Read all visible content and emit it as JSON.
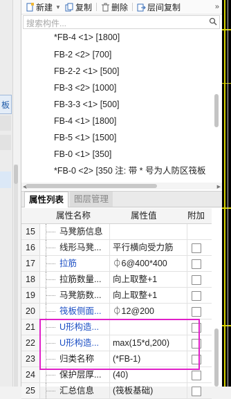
{
  "left_strip": {
    "tab_label": "板"
  },
  "toolbar": {
    "new_label": "新建",
    "copy_label": "复制",
    "delete_label": "删除",
    "floor_copy_label": "层间复制",
    "more_label": "»"
  },
  "search": {
    "placeholder": "搜索构件..."
  },
  "component_list": [
    "*FB-4 <1> [1800]",
    "FB-2 <2> [700]",
    "FB-2-2 <1> [500]",
    "FB-3 <2> [1000]",
    "FB-3-3 <1> [500]",
    "FB-4 <1> [1800]",
    "FB-5 <1> [1500]",
    "FB-0 <1> [350]",
    "*FB-0 <2> [350 注: 带 * 号为人防区筏板"
  ],
  "tabs": {
    "properties": "属性列表",
    "layers": "图层管理"
  },
  "grid": {
    "headers": {
      "name": "属性名称",
      "value": "属性值",
      "extra": "附加"
    },
    "rows": [
      {
        "num": "15",
        "name": "马凳筋信息",
        "value": "",
        "blue": false,
        "checkbox": false
      },
      {
        "num": "16",
        "name": "线形马凳...",
        "value": "平行横向受力筋",
        "blue": false,
        "checkbox": true
      },
      {
        "num": "17",
        "name": "拉筋",
        "value": "⏀6@400*400",
        "blue": true,
        "checkbox": true
      },
      {
        "num": "18",
        "name": "拉筋数量...",
        "value": "向上取整+1",
        "blue": false,
        "checkbox": true
      },
      {
        "num": "19",
        "name": "马凳筋数...",
        "value": "向上取整+1",
        "blue": false,
        "checkbox": true
      },
      {
        "num": "20",
        "name": "筏板侧面...",
        "value": "⏀12@200",
        "blue": true,
        "checkbox": true
      },
      {
        "num": "21",
        "name": "U形构造...",
        "value": "",
        "blue": true,
        "checkbox": true
      },
      {
        "num": "22",
        "name": "U形构造...",
        "value": "max(15*d,200)",
        "blue": true,
        "checkbox": true
      },
      {
        "num": "23",
        "name": "归类名称",
        "value": "(*FB-1)",
        "blue": false,
        "checkbox": true
      },
      {
        "num": "24",
        "name": "保护层厚...",
        "value": "(40)",
        "blue": false,
        "checkbox": true
      },
      {
        "num": "25",
        "name": "汇总信息",
        "value": "(筏板基础)",
        "blue": false,
        "checkbox": true
      }
    ]
  },
  "colors": {
    "highlight": "#e020c8",
    "blue_text": "#1c4fc4",
    "cad_yellow": "#d8d400"
  }
}
